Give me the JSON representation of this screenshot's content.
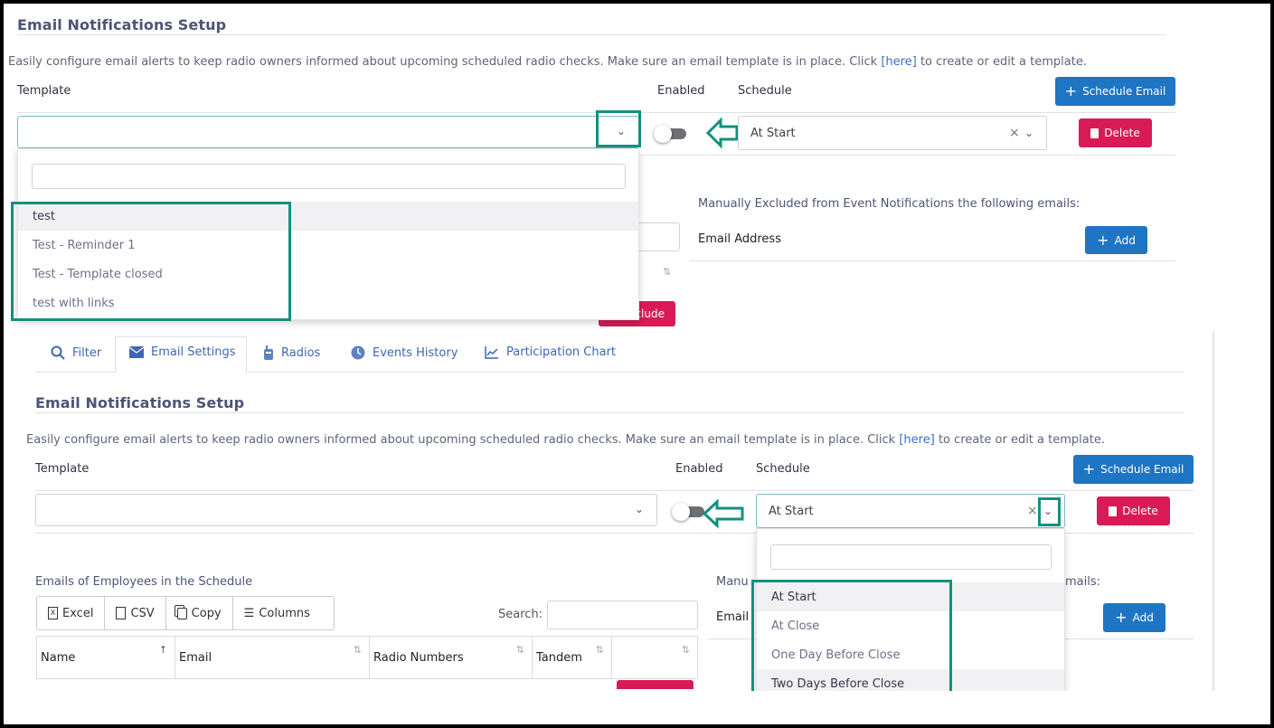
{
  "top": {
    "title": "Email Notifications Setup",
    "info_prefix": "Easily configure email alerts to keep radio owners informed about upcoming scheduled radio checks. Make sure an email template is in place. Click",
    "info_link": "[here]",
    "info_suffix": "to create or edit a template.",
    "col_template": "Template",
    "col_enabled": "Enabled",
    "col_schedule": "Schedule",
    "schedule_btn": "Schedule Email",
    "schedule_value": "At Start",
    "delete_btn": "Delete",
    "template_options": [
      "test",
      "Test - Reminder 1",
      "Test - Template closed",
      "test with links"
    ],
    "excluded_text": "Manually Excluded from Event Notifications the following emails:",
    "email_address_label": "Email Address",
    "add_btn": "Add",
    "hidden_btn_fragment": "clude"
  },
  "bottom": {
    "tabs": [
      {
        "label": "Filter",
        "icon": "search-icon"
      },
      {
        "label": "Email Settings",
        "icon": "envelope-icon"
      },
      {
        "label": "Radios",
        "icon": "radio-icon"
      },
      {
        "label": "Events History",
        "icon": "clock-icon"
      },
      {
        "label": "Participation Chart",
        "icon": "line-chart-icon"
      }
    ],
    "title": "Email Notifications Setup",
    "info_prefix": "Easily configure email alerts to keep radio owners informed about upcoming scheduled radio checks. Make sure an email template is in place. Click",
    "info_link": "[here]",
    "info_suffix": "to create or edit a template.",
    "col_template": "Template",
    "col_enabled": "Enabled",
    "col_schedule": "Schedule",
    "schedule_btn": "Schedule Email",
    "schedule_value": "At Start",
    "delete_btn": "Delete",
    "schedule_options": [
      "At Start",
      "At Close",
      "One Day Before Close",
      "Two Days Before Close"
    ],
    "employees_label": "Emails of Employees in the Schedule",
    "export_buttons": [
      "Excel",
      "CSV",
      "Copy",
      "Columns"
    ],
    "search_label": "Search:",
    "table_headers": [
      "Name",
      "Email",
      "Radio Numbers",
      "Tandem"
    ],
    "excluded_fragment": "Manu",
    "excluded_fragment_end": "mails:",
    "email_fragment": "Email",
    "add_btn": "Add"
  },
  "colors": {
    "accent_blue": "#1e75c3",
    "danger": "#d81b57",
    "highlight_teal": "#12917d",
    "link": "#3b6ec9"
  }
}
